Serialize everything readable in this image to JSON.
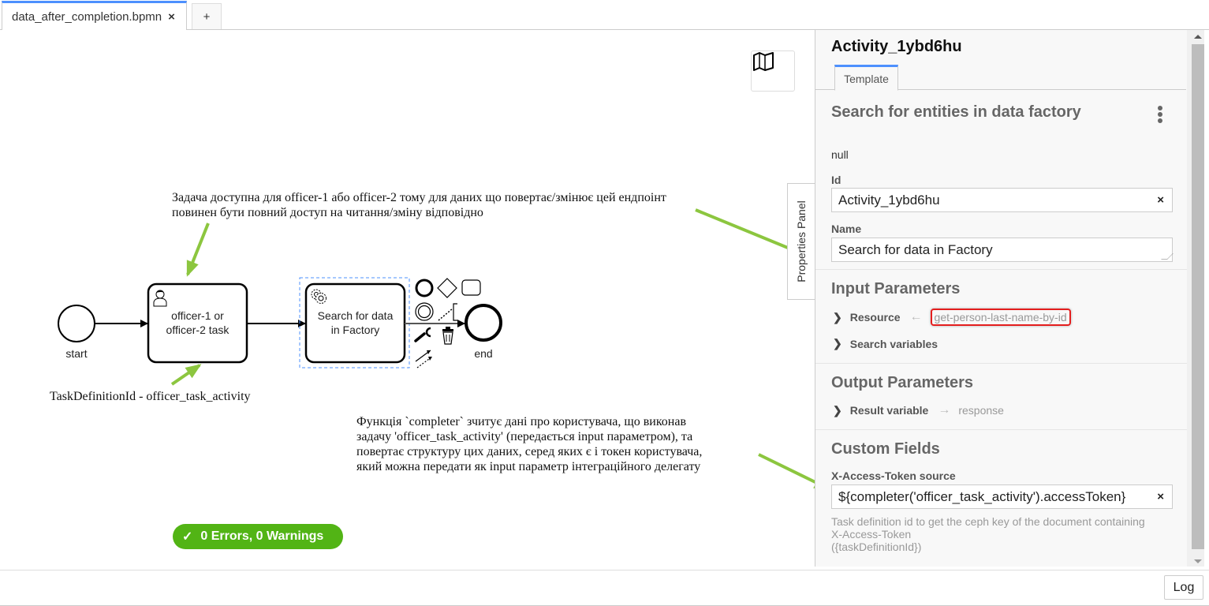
{
  "tabs": {
    "active_file": "data_after_completion.bpmn",
    "close_icon": "×",
    "add_label": "+"
  },
  "canvas": {
    "minimap_icon": "map-icon",
    "elements": {
      "start_label": "start",
      "user_task_label_line1": "officer-1 or",
      "user_task_label_line2": "officer-2 task",
      "service_task_label_line1": "Search for data",
      "service_task_label_line2": "in Factory",
      "end_label": "end"
    },
    "annotations": {
      "top_line1": "Задача доступна для officer-1 або officer-2 тому для даних що повертає/змінює цей ендпоінт",
      "top_line2": "повинен бути повний доступ на читання/зміну відповідно",
      "task_def": "TaskDefinitionId - officer_task_activity",
      "completer_line1": "Функція `completer` зчитує дані про користувача, що виконав",
      "completer_line2": "задачу 'officer_task_activity' (передається input параметром), та",
      "completer_line3": "повертає структуру цих даних, серед яких є і токен користувача,",
      "completer_line4": "який можна передати як input параметр інтеграційного делегату"
    },
    "lint": {
      "icon": "✓",
      "label": "0 Errors, 0 Warnings",
      "color": "#52b415"
    },
    "annotation_arrow_color": "#8cc63f"
  },
  "properties_panel": {
    "toggle_label": "Properties Panel",
    "title": "Activity_1ybd6hu",
    "tab_label": "Template",
    "template_name": "Search for entities in data factory",
    "template_description": "null",
    "id_label": "Id",
    "id_value": "Activity_1ybd6hu",
    "name_label": "Name",
    "name_value": "Search for data in Factory",
    "input_title": "Input Parameters",
    "inputs": [
      {
        "label": "Resource",
        "arrow": "←",
        "value": "get-person-last-name-by-id"
      },
      {
        "label": "Search variables"
      }
    ],
    "output_title": "Output Parameters",
    "outputs": [
      {
        "label": "Result variable",
        "arrow": "→",
        "value": "response"
      }
    ],
    "custom_title": "Custom Fields",
    "token_label": "X-Access-Token source",
    "token_value": "${completer('officer_task_activity').accessToken}",
    "token_desc_line1": "Task definition id to get the ceph key of the document containing",
    "token_desc_line2": "X-Access-Token",
    "token_desc_line3": "({taskDefinitionId})",
    "clear_icon": "×"
  },
  "footer": {
    "log_label": "Log"
  }
}
